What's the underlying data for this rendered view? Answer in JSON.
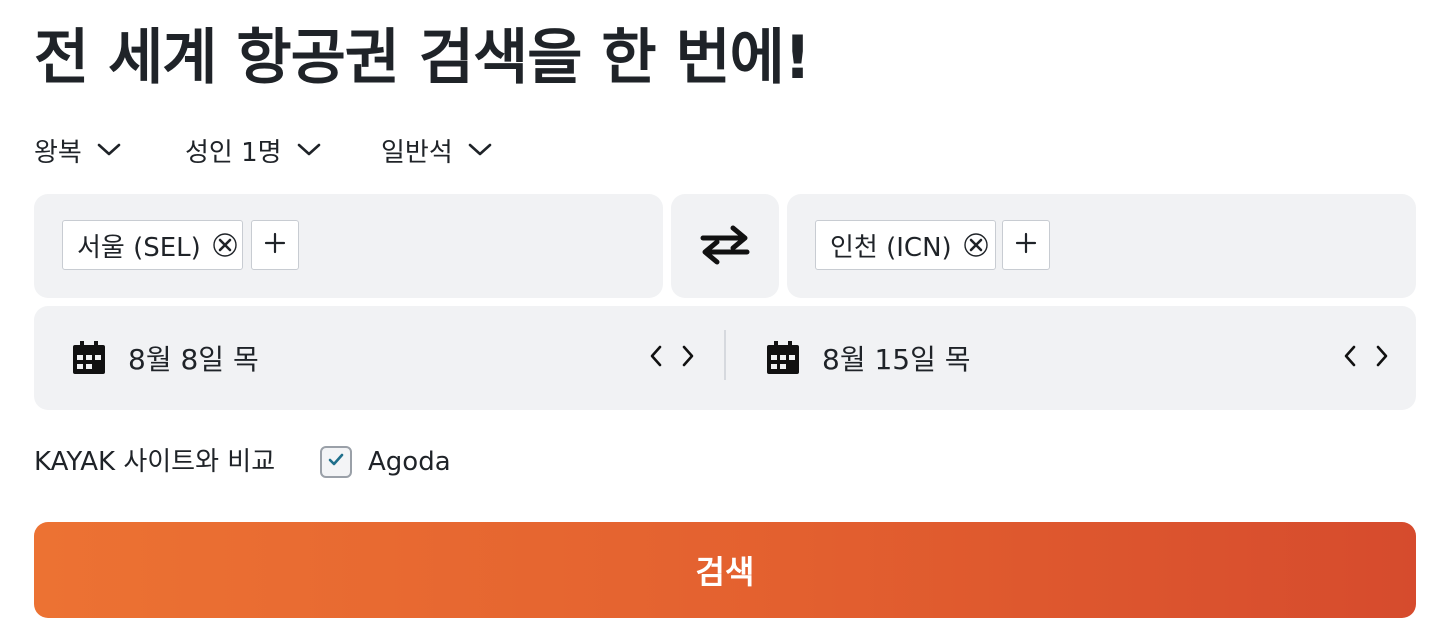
{
  "headline": "전 세계 항공권 검색을 한 번에!",
  "options": {
    "trip_type": "왕복",
    "passengers": "성인 1명",
    "cabin": "일반석"
  },
  "origin": {
    "chip": "서울 (SEL)"
  },
  "destination": {
    "chip": "인천 (ICN)"
  },
  "dates": {
    "depart": "8월 8일 목",
    "return": "8월 15일 목"
  },
  "compare": {
    "label": "KAYAK 사이트와 비교",
    "option": "Agoda",
    "checked": true
  },
  "search_label": "검색",
  "icons": {
    "chevron": "chevron-down-icon",
    "remove": "close-icon",
    "add": "plus-icon",
    "swap": "swap-arrows-icon",
    "calendar": "calendar-icon",
    "prev": "chevron-left-icon",
    "next": "chevron-right-icon",
    "check": "check-icon"
  },
  "colors": {
    "accent_start": "#ec7233",
    "accent_end": "#d64b2d",
    "check": "#1f6f8b",
    "field_bg": "#f1f2f4"
  }
}
